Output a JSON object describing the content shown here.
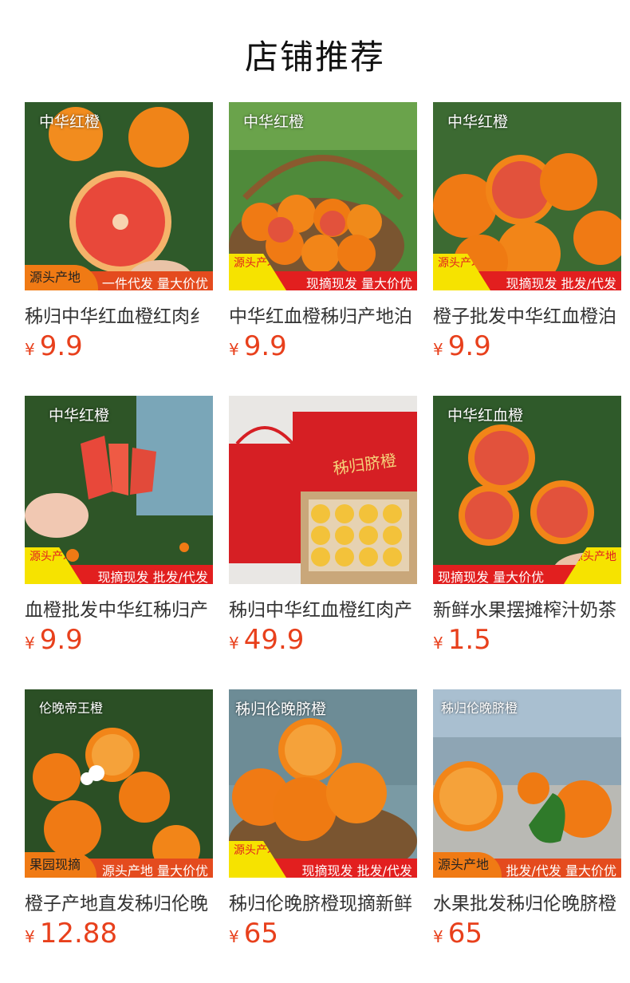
{
  "header": {
    "title": "店铺推荐"
  },
  "products": [
    {
      "title": "秭归中华红血橙红肉纟",
      "price": "9.9",
      "yen": "¥",
      "img_tag": "中华红橙",
      "badge": "源头产地",
      "banner": "一件代发  量大价优"
    },
    {
      "title": "中华红血橙秭归产地泊",
      "price": "9.9",
      "yen": "¥",
      "img_tag": "中华红橙",
      "badge": "源头产地",
      "banner": "现摘现发 量大价优"
    },
    {
      "title": "橙子批发中华红血橙泊",
      "price": "9.9",
      "yen": "¥",
      "img_tag": "中华红橙",
      "badge": "源头产地",
      "banner": "现摘现发  批发/代发"
    },
    {
      "title": "血橙批发中华红秭归产",
      "price": "9.9",
      "yen": "¥",
      "img_tag": "中华红橙",
      "badge": "源头产地",
      "banner": "现摘现发  批发/代发"
    },
    {
      "title": "秭归中华红血橙红肉产",
      "price": "49.9",
      "yen": "¥",
      "img_tag": "秭归脐橙",
      "badge": "",
      "banner": ""
    },
    {
      "title": "新鲜水果摆摊榨汁奶茶",
      "price": "1.5",
      "yen": "¥",
      "img_tag": "中华红血橙",
      "badge": "源头产地",
      "banner": "现摘现发  量大价优"
    },
    {
      "title": "橙子产地直发秭归伦晚",
      "price": "12.88",
      "yen": "¥",
      "img_tag": "伦晚帝王橙",
      "badge": "果园现摘",
      "banner": "源头产地  量大价优"
    },
    {
      "title": "秭归伦晚脐橙现摘新鲜",
      "price": "65",
      "yen": "¥",
      "img_tag": "秭归伦晚脐橙",
      "badge": "源头产地",
      "banner": "现摘现发  批发/代发"
    },
    {
      "title": "水果批发秭归伦晚脐橙",
      "price": "65",
      "yen": "¥",
      "img_tag": "秭归伦晚脐橙",
      "badge": "源头产地",
      "banner": "批发/代发  量大价优"
    }
  ],
  "colors": {
    "price": "#e8401c",
    "banner_red": "#e21f1f",
    "badge_yellow": "#f6e300",
    "orange": "#f07a14"
  }
}
